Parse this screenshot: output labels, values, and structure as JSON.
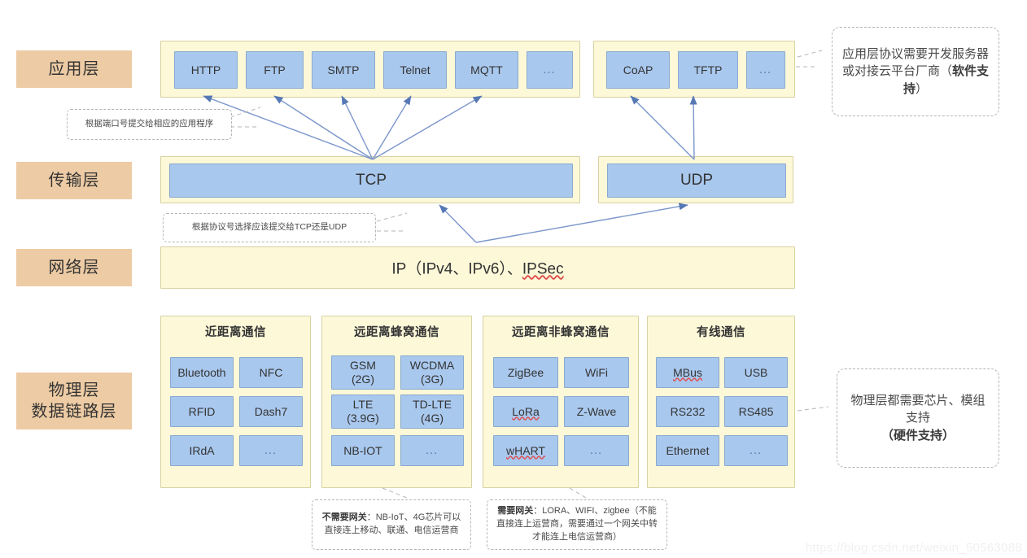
{
  "layers": [
    {
      "id": "application",
      "label": "应用层"
    },
    {
      "id": "transport",
      "label": "传输层"
    },
    {
      "id": "network",
      "label": "网络层"
    },
    {
      "id": "physical",
      "label": "物理层\n数据链路层"
    }
  ],
  "application_layer": {
    "group_tcp": {
      "items": [
        "HTTP",
        "FTP",
        "SMTP",
        "Telnet",
        "MQTT",
        "…"
      ]
    },
    "group_udp": {
      "items": [
        "CoAP",
        "TFTP",
        "…"
      ]
    }
  },
  "transport_layer": {
    "items": [
      "TCP",
      "UDP"
    ]
  },
  "network_layer": {
    "text_prefix": "IP（IPv4、IPv6）、",
    "text_spell": "IPSec"
  },
  "physical_layer": {
    "groups": [
      {
        "title": "近距离通信",
        "items": [
          "Bluetooth",
          "NFC",
          "RFID",
          "Dash7",
          "IRdA",
          "…"
        ]
      },
      {
        "title": "远距离蜂窝通信",
        "items": [
          "GSM\n(2G)",
          "WCDMA\n(3G)",
          "LTE\n(3.9G)",
          "TD-LTE\n(4G)",
          "NB-IOT",
          "…"
        ]
      },
      {
        "title": "远距离非蜂窝通信",
        "items": [
          "ZigBee",
          "WiFi",
          "LoRa",
          "Z-Wave",
          "wHART",
          "…"
        ]
      },
      {
        "title": "有线通信",
        "items": [
          "MBus",
          "USB",
          "RS232",
          "RS485",
          "Ethernet",
          "…"
        ]
      }
    ],
    "spellchecked": [
      "MBus",
      "LoRa",
      "wHART"
    ]
  },
  "callouts": {
    "application": {
      "plain": "应用层协议需要开发服务器或对接云平台厂商（",
      "bold": "软件支持",
      "tail": "）"
    },
    "port_note": "根据端口号提交给相应的应用程序",
    "protocol_note": "根据协议号选择应该提交给TCP还是UDP",
    "physical": {
      "plain": "物理层都需要芯片、模组支持",
      "bold": "（硬件支持）"
    },
    "no_gateway": {
      "bold": "不需要网关",
      "plain": "：NB-IoT、4G芯片可以直接连上移动、联通、电信运营商"
    },
    "need_gateway": {
      "bold": "需要网关",
      "plain": "：LORA、WIFI、zigbee（不能直接连上运营商，需要通过一个网关中转才能连上电信运营商）"
    }
  },
  "watermark": "https://blog.csdn.net/weixin_50563088",
  "colors": {
    "layer_label_bg": "#edcba4",
    "group_bg": "#fcf8d8",
    "group_border": "#d9d2a3",
    "chip_bg": "#a9c8ee",
    "chip_border": "#8aa9cd",
    "arrow": "#5678b4",
    "spellcheck": "#e04b4b"
  }
}
